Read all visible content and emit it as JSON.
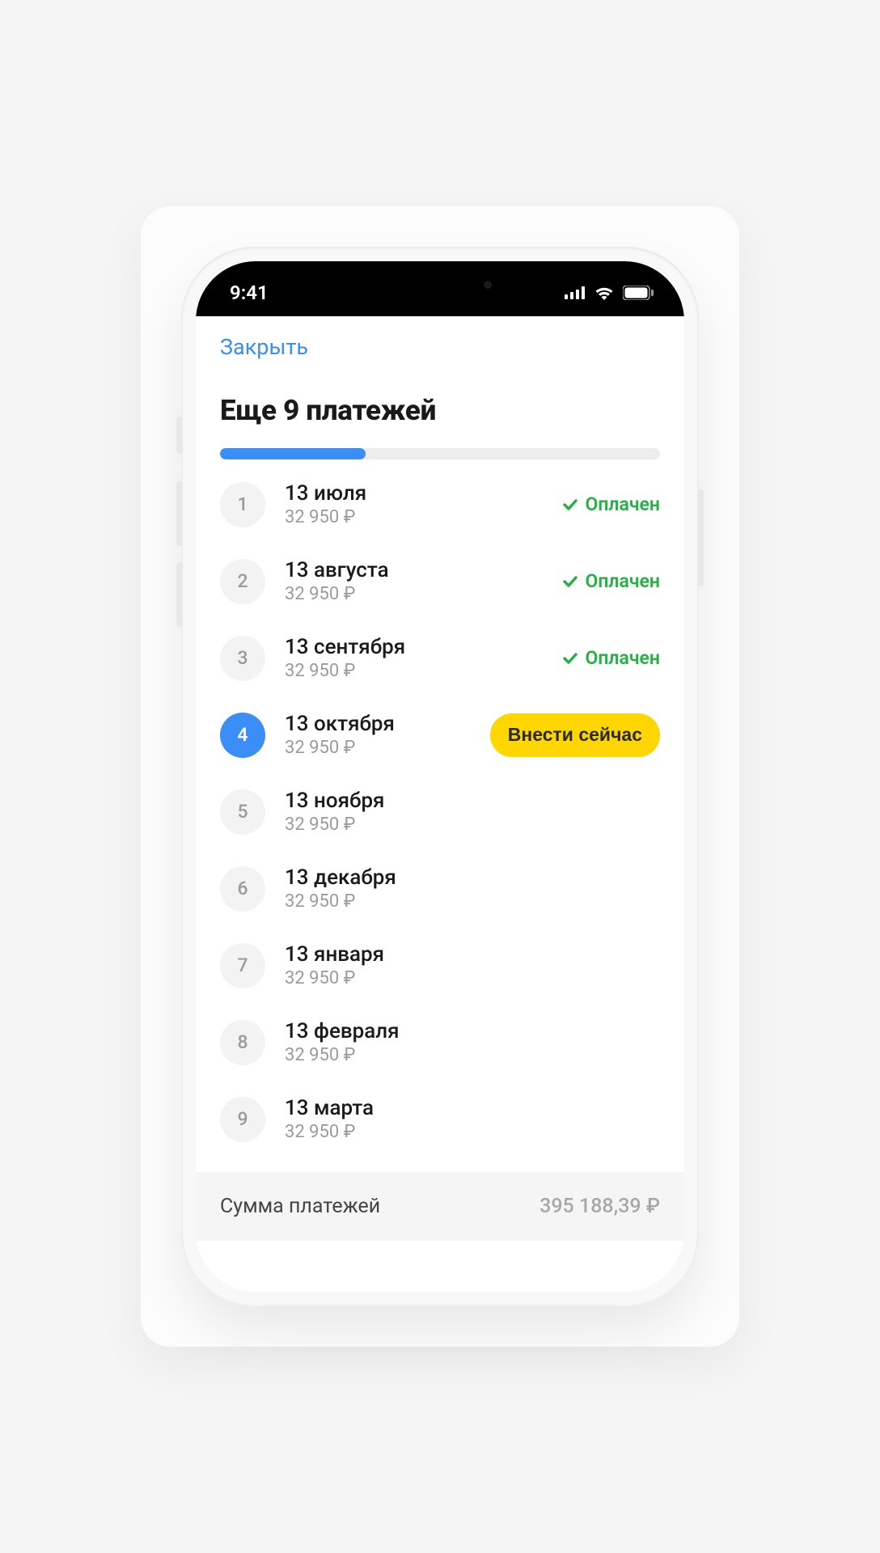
{
  "statusbar": {
    "time": "9:41"
  },
  "close_label": "Закрыть",
  "title": "Еще 9 платежей",
  "progress_percent": 33,
  "status_paid": "Оплачен",
  "pay_now": "Внести сейчас",
  "payments": [
    {
      "n": "1",
      "date": "13 июля",
      "amount": "32 950 ₽",
      "state": "paid"
    },
    {
      "n": "2",
      "date": "13 августа",
      "amount": "32 950 ₽",
      "state": "paid"
    },
    {
      "n": "3",
      "date": "13 сентября",
      "amount": "32 950 ₽",
      "state": "paid"
    },
    {
      "n": "4",
      "date": "13 октября",
      "amount": "32 950 ₽",
      "state": "due"
    },
    {
      "n": "5",
      "date": "13 ноября",
      "amount": "32 950 ₽",
      "state": "future"
    },
    {
      "n": "6",
      "date": "13 декабря",
      "amount": "32 950 ₽",
      "state": "future"
    },
    {
      "n": "7",
      "date": "13 января",
      "amount": "32 950 ₽",
      "state": "future"
    },
    {
      "n": "8",
      "date": "13 февраля",
      "amount": "32 950 ₽",
      "state": "future"
    },
    {
      "n": "9",
      "date": "13 марта",
      "amount": "32 950 ₽",
      "state": "future"
    }
  ],
  "footer": {
    "label": "Сумма платежей",
    "value": "395 188,39 ₽"
  }
}
